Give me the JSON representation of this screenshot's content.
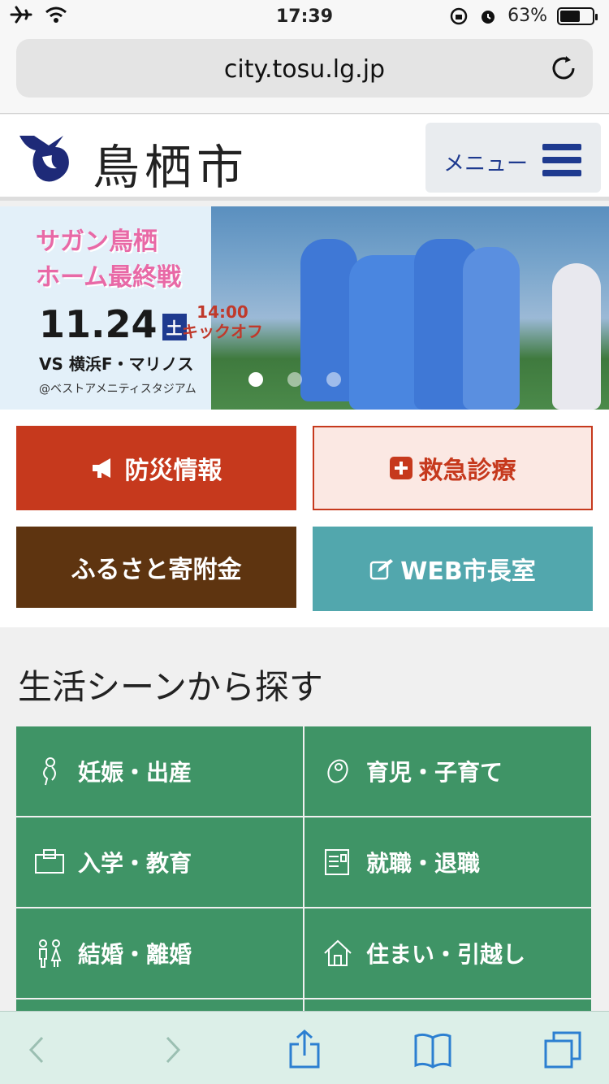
{
  "status_bar": {
    "time": "17:39",
    "battery_percent": "63%",
    "battery_level": 0.63
  },
  "browser": {
    "url": "city.tosu.lg.jp"
  },
  "header": {
    "site_name": "鳥栖市",
    "menu_label": "メニュー"
  },
  "banner": {
    "line1": "サガン鳥栖",
    "line2": "ホーム最終戦",
    "date": "11.24",
    "weekday": "土",
    "kickoff_time": "14:00",
    "kickoff_label": "キックオフ",
    "opponent": "VS  横浜F・マリノス",
    "venue": "@ベストアメニティスタジアム",
    "slides_total": 3,
    "active_slide": 1
  },
  "quick_links": {
    "disaster": "防災情報",
    "emergency": "救急診療",
    "furusato": "ふるさと寄附金",
    "mayor": "WEB市長室"
  },
  "life_scenes": {
    "title": "生活シーンから探す",
    "items": [
      {
        "label": "妊娠・出産",
        "icon": "pregnancy-icon"
      },
      {
        "label": "育児・子育て",
        "icon": "baby-icon"
      },
      {
        "label": "入学・教育",
        "icon": "school-bag-icon"
      },
      {
        "label": "就職・退職",
        "icon": "resume-icon"
      },
      {
        "label": "結婚・離婚",
        "icon": "couple-icon"
      },
      {
        "label": "住まい・引越し",
        "icon": "house-icon"
      }
    ]
  },
  "colors": {
    "brand_navy": "#1e3a8f",
    "disaster_red": "#c6391d",
    "furusato_brown": "#5e3410",
    "mayor_teal": "#52a7ad",
    "scene_green": "#3f9466"
  }
}
